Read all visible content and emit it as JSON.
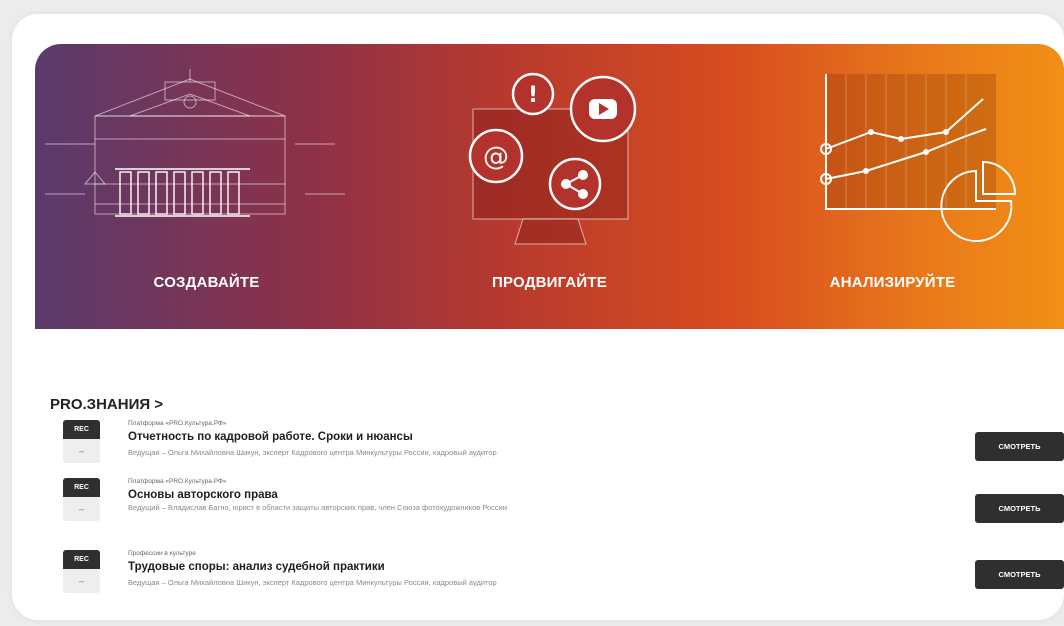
{
  "banner": {
    "items": [
      {
        "label": "СОЗДАВАЙТЕ",
        "icon": "theater-building-icon"
      },
      {
        "label": "ПРОДВИГАЙТЕ",
        "icon": "monitor-social-icon"
      },
      {
        "label": "АНАЛИЗИРУЙТЕ",
        "icon": "analytics-chart-icon"
      }
    ]
  },
  "section": {
    "title": "PRO.ЗНАНИЯ >"
  },
  "courses": [
    {
      "badge": "REC",
      "badge_sub": "–",
      "platform": "Платформа «PRO.Культура.РФ»",
      "title": "Отчетность по кадровой работе. Сроки и нюансы",
      "host": "Ведущая – Ольга Михайловна Шикун, эксперт Кадрового центра Минкультуры России, кадровый аудитор",
      "button": "СМОТРЕТЬ"
    },
    {
      "badge": "REC",
      "badge_sub": "–",
      "platform": "Платформа «PRO.Культура.РФ»",
      "title": "Основы авторского права",
      "host": "Ведущий – Владислав Багно, юрист в области защиты авторских прав, член Союза фотохудожников России",
      "button": "СМОТРЕТЬ"
    },
    {
      "badge": "REC",
      "badge_sub": "–",
      "platform": "Профессии в культуре",
      "title": "Трудовые споры: анализ судебной практики",
      "host": "Ведущая – Ольга Михайловна Шикун, эксперт Кадрового центра Минкультуры России, кадровый аудитор",
      "button": "СМОТРЕТЬ"
    }
  ],
  "colors": {
    "banner_start": "#5a3a6c",
    "banner_mid": "#b6392f",
    "banner_end": "#f29015",
    "button": "#2f2f2f"
  }
}
